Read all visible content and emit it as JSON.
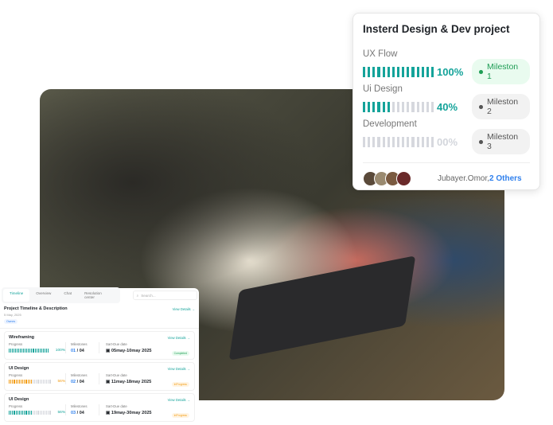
{
  "project_card": {
    "title": "Insterd Design & Dev project",
    "items": [
      {
        "label": "UX Flow",
        "percent": "100%",
        "value": 1.0,
        "milestone": "Mileston 1",
        "active": true
      },
      {
        "label": "Ui Design",
        "percent": "40%",
        "value": 0.4,
        "milestone": "Mileston 2",
        "active": false
      },
      {
        "label": "Development",
        "percent": "00%",
        "value": 0,
        "milestone": "Mileston 3",
        "active": false
      }
    ],
    "members": "Jubayer.Omor,",
    "others": "2 Others"
  },
  "dashboard": {
    "tabs": [
      "Timeline",
      "Overview",
      "Chat",
      "Resolution center"
    ],
    "active_tab": "Timeline",
    "search_placeholder": "Search...",
    "header": {
      "title": "Project Timeline & Description",
      "date": "5 May, 2025",
      "tag": "Ownes",
      "view": "View Details →"
    },
    "labels": {
      "progress": "Progress",
      "milestones": "Milestones",
      "dates": "Sart-Due date",
      "view": "View Details →"
    },
    "tasks": [
      {
        "title": "Wireframing",
        "percent": "100%",
        "value": 1.0,
        "done": "01",
        "total": "04",
        "dates": "05may-10may 2025",
        "status": "Completed",
        "color": "teal"
      },
      {
        "title": "UI Design",
        "percent": "56%",
        "value": 0.56,
        "done": "02",
        "total": "04",
        "dates": "11may-18may 2025",
        "status": "InProgress",
        "color": "orange"
      },
      {
        "title": "UI Design",
        "percent": "56%",
        "value": 0.56,
        "done": "03",
        "total": "04",
        "dates": "19may-30may 2025",
        "status": "InProgress",
        "color": "teal"
      }
    ]
  },
  "colors": {
    "accent": "#14a39a",
    "blue": "#2f80ed",
    "orange": "#f39c12",
    "green": "#1f9d55"
  }
}
